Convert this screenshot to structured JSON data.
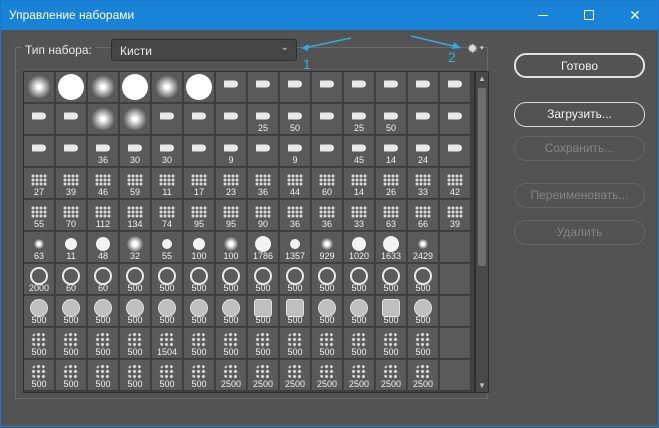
{
  "window": {
    "title": "Управление наборами",
    "minimize_icon": "minimize-icon",
    "maximize_icon": "maximize-icon",
    "close_icon": "close-icon"
  },
  "preset_type": {
    "label": "Тип набора:",
    "value": "Кисти"
  },
  "settings_icon": "gear-icon",
  "annotations": {
    "marker_1": "1",
    "marker_2": "2",
    "color": "#35a9e8"
  },
  "buttons": {
    "done": "Готово",
    "load": "Загрузить...",
    "save": "Сохранить...",
    "rename": "Переименовать...",
    "delete": "Удалить"
  },
  "brush_grid": {
    "columns": 14,
    "rows": [
      [
        "",
        "",
        "",
        "",
        "",
        "",
        "",
        "",
        "",
        "",
        "",
        "",
        "",
        ""
      ],
      [
        "",
        "",
        "",
        "",
        "",
        "",
        "",
        "25",
        "50",
        "",
        "25",
        "50",
        "",
        ""
      ],
      [
        "",
        "",
        "36",
        "30",
        "30",
        "",
        "9",
        "",
        "9",
        "",
        "45",
        "14",
        "24",
        ""
      ],
      [
        "27",
        "39",
        "46",
        "59",
        "11",
        "17",
        "23",
        "36",
        "44",
        "60",
        "14",
        "26",
        "33",
        "42"
      ],
      [
        "55",
        "70",
        "112",
        "134",
        "74",
        "95",
        "95",
        "90",
        "36",
        "36",
        "33",
        "63",
        "66",
        "39"
      ],
      [
        "63",
        "11",
        "48",
        "32",
        "55",
        "100",
        "100",
        "1786",
        "1357",
        "929",
        "1020",
        "1633",
        "2429",
        ""
      ],
      [
        "2000",
        "60",
        "60",
        "500",
        "500",
        "500",
        "500",
        "500",
        "500",
        "500",
        "500",
        "500",
        "500",
        ""
      ],
      [
        "500",
        "500",
        "500",
        "500",
        "500",
        "500",
        "500",
        "500",
        "500",
        "500",
        "500",
        "500",
        "500",
        ""
      ],
      [
        "500",
        "500",
        "500",
        "500",
        "1504",
        "500",
        "500",
        "500",
        "500",
        "500",
        "500",
        "500",
        "500",
        ""
      ],
      [
        "500",
        "500",
        "500",
        "500",
        "500",
        "500",
        "2500",
        "2500",
        "2500",
        "2500",
        "2500",
        "2500",
        "2500",
        ""
      ]
    ]
  },
  "colors": {
    "titlebar": "#1883d7",
    "panel": "#535353",
    "cell": "#5a5a5a"
  }
}
